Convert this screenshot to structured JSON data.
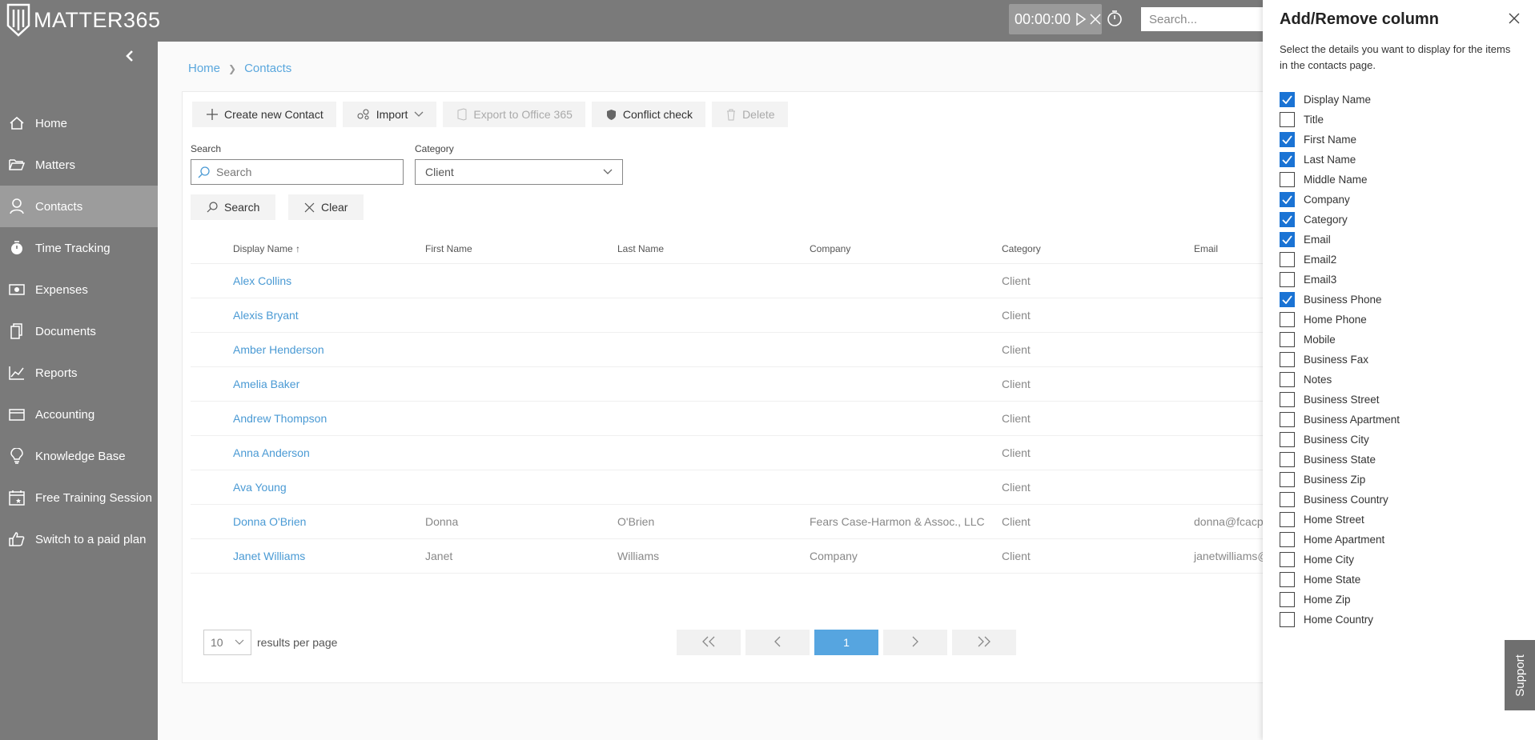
{
  "app": {
    "logo_text": "MATTER365",
    "timer": "00:00:00",
    "search_placeholder": "Search..."
  },
  "sidebar": {
    "items": [
      {
        "label": "Home",
        "icon": "home-icon",
        "active": false
      },
      {
        "label": "Matters",
        "icon": "folder-icon",
        "active": false
      },
      {
        "label": "Contacts",
        "icon": "person-icon",
        "active": true
      },
      {
        "label": "Time Tracking",
        "icon": "timer-icon",
        "active": false
      },
      {
        "label": "Expenses",
        "icon": "money-icon",
        "active": false
      },
      {
        "label": "Documents",
        "icon": "documents-icon",
        "active": false
      },
      {
        "label": "Reports",
        "icon": "chart-icon",
        "active": false
      },
      {
        "label": "Accounting",
        "icon": "wallet-icon",
        "active": false
      },
      {
        "label": "Knowledge Base",
        "icon": "lightbulb-icon",
        "active": false
      },
      {
        "label": "Free Training Session",
        "icon": "calendar-icon",
        "active": false
      },
      {
        "label": "Switch to a paid plan",
        "icon": "thumbs-up-icon",
        "active": false
      }
    ]
  },
  "breadcrumb": {
    "home": "Home",
    "current": "Contacts"
  },
  "toolbar": {
    "create": "Create new Contact",
    "import": "Import",
    "export": "Export to Office 365",
    "conflict": "Conflict check",
    "delete": "Delete"
  },
  "filters": {
    "search_label": "Search",
    "search_placeholder": "Search",
    "category_label": "Category",
    "category_value": "Client",
    "search_button": "Search",
    "clear_button": "Clear"
  },
  "table": {
    "columns": [
      "Display Name",
      "First Name",
      "Last Name",
      "Company",
      "Category",
      "Email"
    ],
    "rows": [
      {
        "display_name": "Alex Collins",
        "first_name": "",
        "last_name": "",
        "company": "",
        "category": "Client",
        "email": ""
      },
      {
        "display_name": "Alexis Bryant",
        "first_name": "",
        "last_name": "",
        "company": "",
        "category": "Client",
        "email": ""
      },
      {
        "display_name": "Amber Henderson",
        "first_name": "",
        "last_name": "",
        "company": "",
        "category": "Client",
        "email": ""
      },
      {
        "display_name": "Amelia Baker",
        "first_name": "",
        "last_name": "",
        "company": "",
        "category": "Client",
        "email": ""
      },
      {
        "display_name": "Andrew Thompson",
        "first_name": "",
        "last_name": "",
        "company": "",
        "category": "Client",
        "email": ""
      },
      {
        "display_name": "Anna Anderson",
        "first_name": "",
        "last_name": "",
        "company": "",
        "category": "Client",
        "email": ""
      },
      {
        "display_name": "Ava Young",
        "first_name": "",
        "last_name": "",
        "company": "",
        "category": "Client",
        "email": ""
      },
      {
        "display_name": "Donna O'Brien",
        "first_name": "Donna",
        "last_name": "O'Brien",
        "company": "Fears Case-Harmon & Assoc., LLC",
        "category": "Client",
        "email": "donna@fcacp"
      },
      {
        "display_name": "Janet Williams",
        "first_name": "Janet",
        "last_name": "Williams",
        "company": "Company",
        "category": "Client",
        "email": "janetwilliams@"
      }
    ]
  },
  "pagination": {
    "per_page": "10",
    "per_page_label": "results per page",
    "current_page": "1"
  },
  "panel": {
    "title": "Add/Remove column",
    "description": "Select the details you want to display for the items in the contacts page.",
    "columns": [
      {
        "label": "Display Name",
        "checked": true
      },
      {
        "label": "Title",
        "checked": false
      },
      {
        "label": "First Name",
        "checked": true
      },
      {
        "label": "Last Name",
        "checked": true
      },
      {
        "label": "Middle Name",
        "checked": false
      },
      {
        "label": "Company",
        "checked": true
      },
      {
        "label": "Category",
        "checked": true
      },
      {
        "label": "Email",
        "checked": true
      },
      {
        "label": "Email2",
        "checked": false
      },
      {
        "label": "Email3",
        "checked": false
      },
      {
        "label": "Business Phone",
        "checked": true
      },
      {
        "label": "Home Phone",
        "checked": false
      },
      {
        "label": "Mobile",
        "checked": false
      },
      {
        "label": "Business Fax",
        "checked": false
      },
      {
        "label": "Notes",
        "checked": false
      },
      {
        "label": "Business Street",
        "checked": false
      },
      {
        "label": "Business Apartment",
        "checked": false
      },
      {
        "label": "Business City",
        "checked": false
      },
      {
        "label": "Business State",
        "checked": false
      },
      {
        "label": "Business Zip",
        "checked": false
      },
      {
        "label": "Business Country",
        "checked": false
      },
      {
        "label": "Home Street",
        "checked": false
      },
      {
        "label": "Home Apartment",
        "checked": false
      },
      {
        "label": "Home City",
        "checked": false
      },
      {
        "label": "Home State",
        "checked": false
      },
      {
        "label": "Home Zip",
        "checked": false
      },
      {
        "label": "Home Country",
        "checked": false
      }
    ]
  },
  "support_label": "Support",
  "colors": {
    "accent": "#56a5e0",
    "checkbox": "#1a73d4",
    "sidebar": "#7a7a7a",
    "link": "#4a9ad4"
  }
}
